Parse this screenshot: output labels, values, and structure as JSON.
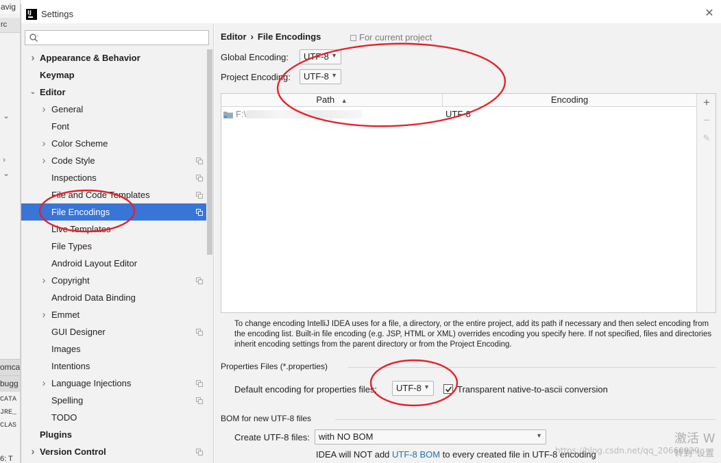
{
  "background_ide": {
    "menu_text": "avig",
    "tab_text": "rc",
    "tabs": [
      "omca",
      "bugg"
    ],
    "log_lines": [
      "CATA",
      "JRE_",
      "CLAS"
    ],
    "status_text": "6: T"
  },
  "dialog": {
    "title": "Settings",
    "logo_text": "IJ"
  },
  "sidebar": {
    "search_placeholder": "",
    "items": [
      {
        "label": "Appearance & Behavior",
        "bold": true,
        "level": 0,
        "arrow": "collapsed",
        "copy": false
      },
      {
        "label": "Keymap",
        "bold": true,
        "level": 0,
        "arrow": "none",
        "copy": false
      },
      {
        "label": "Editor",
        "bold": true,
        "level": 0,
        "arrow": "expanded",
        "copy": false
      },
      {
        "label": "General",
        "bold": false,
        "level": 1,
        "arrow": "collapsed",
        "copy": false
      },
      {
        "label": "Font",
        "bold": false,
        "level": 1,
        "arrow": "none",
        "copy": false
      },
      {
        "label": "Color Scheme",
        "bold": false,
        "level": 1,
        "arrow": "collapsed",
        "copy": false
      },
      {
        "label": "Code Style",
        "bold": false,
        "level": 1,
        "arrow": "collapsed",
        "copy": true
      },
      {
        "label": "Inspections",
        "bold": false,
        "level": 1,
        "arrow": "none",
        "copy": true
      },
      {
        "label": "File and Code Templates",
        "bold": false,
        "level": 1,
        "arrow": "none",
        "copy": true
      },
      {
        "label": "File Encodings",
        "bold": false,
        "level": 1,
        "arrow": "none",
        "copy": true,
        "selected": true
      },
      {
        "label": "Live Templates",
        "bold": false,
        "level": 1,
        "arrow": "none",
        "copy": false
      },
      {
        "label": "File Types",
        "bold": false,
        "level": 1,
        "arrow": "none",
        "copy": false
      },
      {
        "label": "Android Layout Editor",
        "bold": false,
        "level": 1,
        "arrow": "none",
        "copy": false
      },
      {
        "label": "Copyright",
        "bold": false,
        "level": 1,
        "arrow": "collapsed",
        "copy": true
      },
      {
        "label": "Android Data Binding",
        "bold": false,
        "level": 1,
        "arrow": "none",
        "copy": false
      },
      {
        "label": "Emmet",
        "bold": false,
        "level": 1,
        "arrow": "collapsed",
        "copy": false
      },
      {
        "label": "GUI Designer",
        "bold": false,
        "level": 1,
        "arrow": "none",
        "copy": true
      },
      {
        "label": "Images",
        "bold": false,
        "level": 1,
        "arrow": "none",
        "copy": false
      },
      {
        "label": "Intentions",
        "bold": false,
        "level": 1,
        "arrow": "none",
        "copy": false
      },
      {
        "label": "Language Injections",
        "bold": false,
        "level": 1,
        "arrow": "collapsed",
        "copy": true
      },
      {
        "label": "Spelling",
        "bold": false,
        "level": 1,
        "arrow": "none",
        "copy": true
      },
      {
        "label": "TODO",
        "bold": false,
        "level": 1,
        "arrow": "none",
        "copy": false
      },
      {
        "label": "Plugins",
        "bold": true,
        "level": 0,
        "arrow": "none",
        "copy": false
      },
      {
        "label": "Version Control",
        "bold": true,
        "level": 0,
        "arrow": "collapsed",
        "copy": true
      }
    ]
  },
  "main": {
    "breadcrumb_parent": "Editor",
    "breadcrumb_separator": "›",
    "breadcrumb_current": "File Encodings",
    "for_current_project": "For current project",
    "global_encoding_label": "Global Encoding:",
    "global_encoding_value": "UTF-8",
    "project_encoding_label": "Project Encoding:",
    "project_encoding_value": "UTF-8",
    "table": {
      "columns": [
        "Path",
        "Encoding"
      ],
      "sort_indicator": "▲",
      "rows": [
        {
          "path": "F:\\",
          "encoding": "UTF-8"
        }
      ]
    },
    "side_buttons": {
      "add": "+",
      "remove": "−",
      "edit": "✎"
    },
    "help_text": "To change encoding IntelliJ IDEA uses for a file, a directory, or the entire project, add its path if necessary and then select encoding from the encoding list. Built-in file encoding (e.g. JSP, HTML or XML) overrides encoding you specify here. If not specified, files and directories inherit encoding settings from the parent directory or from the Project Encoding.",
    "properties_section_title": "Properties Files (*.properties)",
    "default_properties_label": "Default encoding for properties files:",
    "default_properties_value": "UTF-8",
    "transparent_label": "Transparent native-to-ascii conversion",
    "transparent_checked": true,
    "bom_section_title": "BOM for new UTF-8 files",
    "create_utf8_label": "Create UTF-8 files:",
    "create_utf8_value": "with NO BOM",
    "bom_note_prefix": "IDEA will NOT add ",
    "bom_note_link": "UTF-8 BOM",
    "bom_note_suffix": " to every created file in UTF-8 encoding"
  },
  "overlay": {
    "watermark_activate": "激活 W",
    "watermark_settings": "转到\"设置",
    "watermark_url": "https://blog.csdn.net/qq_20660929"
  },
  "colors": {
    "selection": "#3875d7",
    "annotation_red": "#e8202a",
    "link": "#2470b3"
  }
}
